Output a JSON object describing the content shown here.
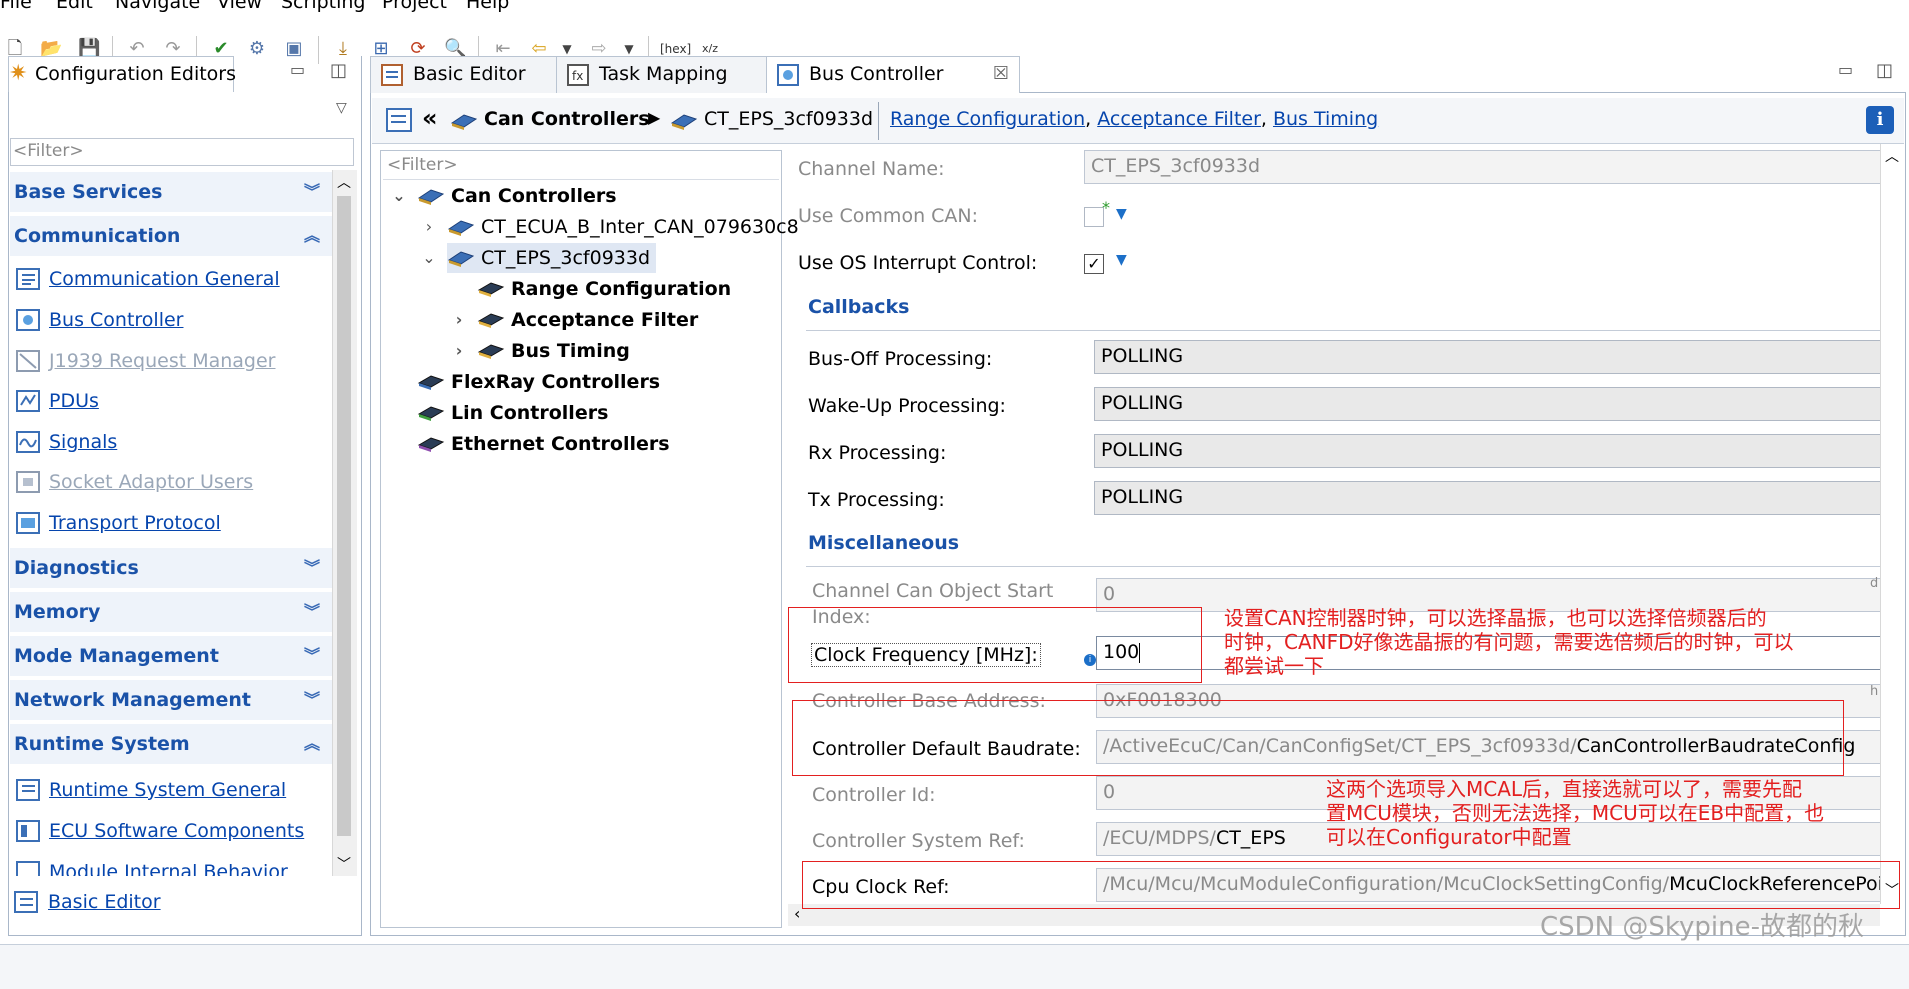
{
  "menu": [
    "File",
    "Edit",
    "Navigate",
    "View",
    "Scripting",
    "Project",
    "Help"
  ],
  "left_panel": {
    "title": "Configuration Editors",
    "filter_placeholder": "<Filter>",
    "sections": [
      {
        "label": "Base Services",
        "expanded": false
      },
      {
        "label": "Communication",
        "expanded": true,
        "items": [
          {
            "label": "Communication General",
            "enabled": true
          },
          {
            "label": "Bus Controller",
            "enabled": true
          },
          {
            "label": "J1939 Request Manager",
            "enabled": false
          },
          {
            "label": "PDUs",
            "enabled": true
          },
          {
            "label": "Signals",
            "enabled": true
          },
          {
            "label": "Socket Adaptor Users",
            "enabled": false
          },
          {
            "label": "Transport Protocol",
            "enabled": true
          }
        ]
      },
      {
        "label": "Diagnostics",
        "expanded": false
      },
      {
        "label": "Memory",
        "expanded": false
      },
      {
        "label": "Mode Management",
        "expanded": false
      },
      {
        "label": "Network Management",
        "expanded": false
      },
      {
        "label": "Runtime System",
        "expanded": true,
        "items": [
          {
            "label": "Runtime System General",
            "enabled": true
          },
          {
            "label": "ECU Software Components",
            "enabled": true
          },
          {
            "label": "Module Internal Behavior",
            "enabled": true
          }
        ]
      }
    ],
    "footer_link": "Basic Editor"
  },
  "editor_tabs": [
    {
      "label": "Basic Editor",
      "active": false
    },
    {
      "label": "Task Mapping",
      "active": false
    },
    {
      "label": "Bus Controller",
      "active": true
    }
  ],
  "breadcrumb": {
    "root": "Can Controllers",
    "current": "CT_EPS_3cf0933d",
    "links": [
      "Range Configuration",
      "Acceptance Filter",
      "Bus Timing"
    ],
    "separator": ","
  },
  "tree": {
    "filter_placeholder": "<Filter>",
    "nodes": [
      {
        "label": "Can Controllers",
        "bold": true,
        "expanded": true
      },
      {
        "label": "CT_ECUA_B_Inter_CAN_079630c8",
        "bold": false,
        "expanded": false
      },
      {
        "label": "CT_EPS_3cf0933d",
        "bold": false,
        "expanded": true,
        "selected": true
      },
      {
        "label": "Range Configuration",
        "bold": true
      },
      {
        "label": "Acceptance Filter",
        "bold": true,
        "expanded": false
      },
      {
        "label": "Bus Timing",
        "bold": true,
        "expanded": false
      },
      {
        "label": "FlexRay Controllers",
        "bold": true
      },
      {
        "label": "Lin Controllers",
        "bold": true
      },
      {
        "label": "Ethernet Controllers",
        "bold": true
      }
    ]
  },
  "form": {
    "channel_name": {
      "label": "Channel Name:",
      "value": "CT_EPS_3cf0933d"
    },
    "use_common_can": {
      "label": "Use Common CAN:",
      "checked": false
    },
    "use_os_interrupt": {
      "label": "Use OS Interrupt Control:",
      "checked": true
    },
    "callbacks_title": "Callbacks",
    "bus_off": {
      "label": "Bus-Off Processing:",
      "value": "POLLING"
    },
    "wake_up": {
      "label": "Wake-Up Processing:",
      "value": "POLLING"
    },
    "rx": {
      "label": "Rx Processing:",
      "value": "POLLING"
    },
    "tx": {
      "label": "Tx Processing:",
      "value": "POLLING"
    },
    "misc_title": "Miscellaneous",
    "obj_start_index": {
      "label1": "Channel Can Object Start",
      "label2": "Index:",
      "value": "0",
      "suffix": "d"
    },
    "clock_freq": {
      "label": "Clock Frequency [MHz]:",
      "value": "100"
    },
    "base_address": {
      "label": "Controller Base Address:",
      "value": "0xF0018300",
      "suffix": "h"
    },
    "default_baudrate": {
      "label": "Controller Default Baudrate:",
      "path": "/ActiveEcuC/Can/CanConfigSet/CT_EPS_3cf0933d/",
      "tail": "CanControllerBaudrateConfig"
    },
    "controller_id": {
      "label": "Controller Id:",
      "value": "0"
    },
    "system_ref": {
      "label": "Controller System Ref:",
      "path": "/ECU/MDPS/",
      "tail": "CT_EPS"
    },
    "cpu_clock_ref": {
      "label": "Cpu Clock Ref:",
      "path": "/Mcu/Mcu/McuModuleConfiguration/McuClockSettingConfig/",
      "tail": "McuClockReferencePoi"
    }
  },
  "annotations": {
    "note1": [
      "设置CAN控制器时钟，可以选择晶振，也可以选择倍频器后的",
      "时钟，CANFD好像选晶振的有问题，需要选倍频后的时钟，可以",
      "都尝试一下"
    ],
    "note2": [
      "这两个选项导入MCAL后，直接选就可以了，需要先配",
      "置MCU模块，否则无法选择，MCU可以在EB中配置，也",
      "可以在Configurator中配置"
    ]
  },
  "watermark": "CSDN @Skypine-故都的秋"
}
